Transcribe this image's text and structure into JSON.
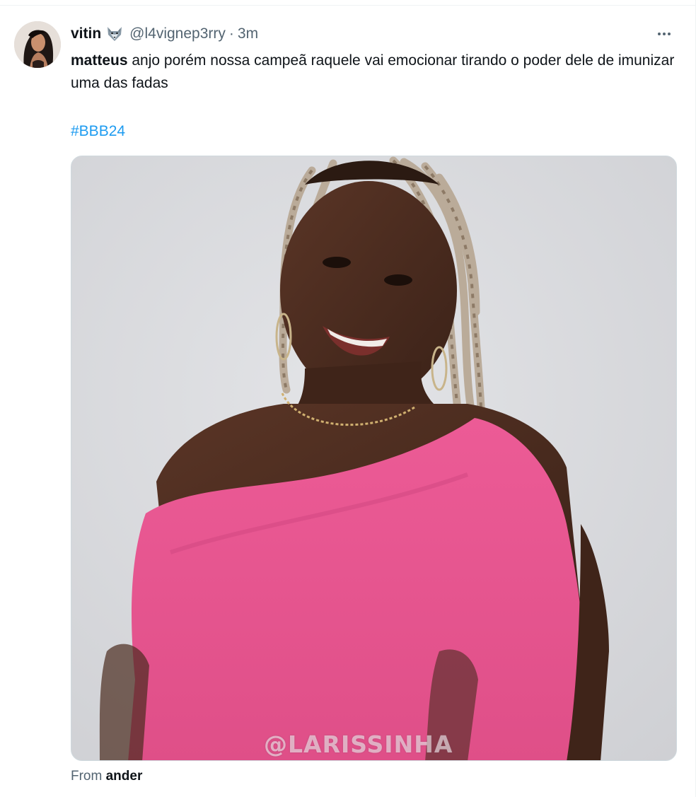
{
  "tweet": {
    "display_name": "vitin",
    "name_emoji_icon": "wolf-face-icon",
    "handle": "@l4vignep3rry",
    "separator": "·",
    "timestamp": "3m",
    "more_icon": "more-horizontal-icon",
    "mention": "matteus",
    "text": " anjo porém nossa campeã raquele vai emocionar tirando o poder dele de imunizar uma das fadas",
    "hashtag": "#BBB24",
    "media": {
      "watermark": "@LARISSINHA"
    },
    "attribution": {
      "prefix": "From ",
      "source": "ander"
    }
  },
  "colors": {
    "text_primary": "#0f1419",
    "text_secondary": "#536471",
    "link": "#1d9bf0",
    "border": "#cfd9de",
    "shirt_pink": "#e8548f",
    "wall_gray": "#d9dadd"
  }
}
